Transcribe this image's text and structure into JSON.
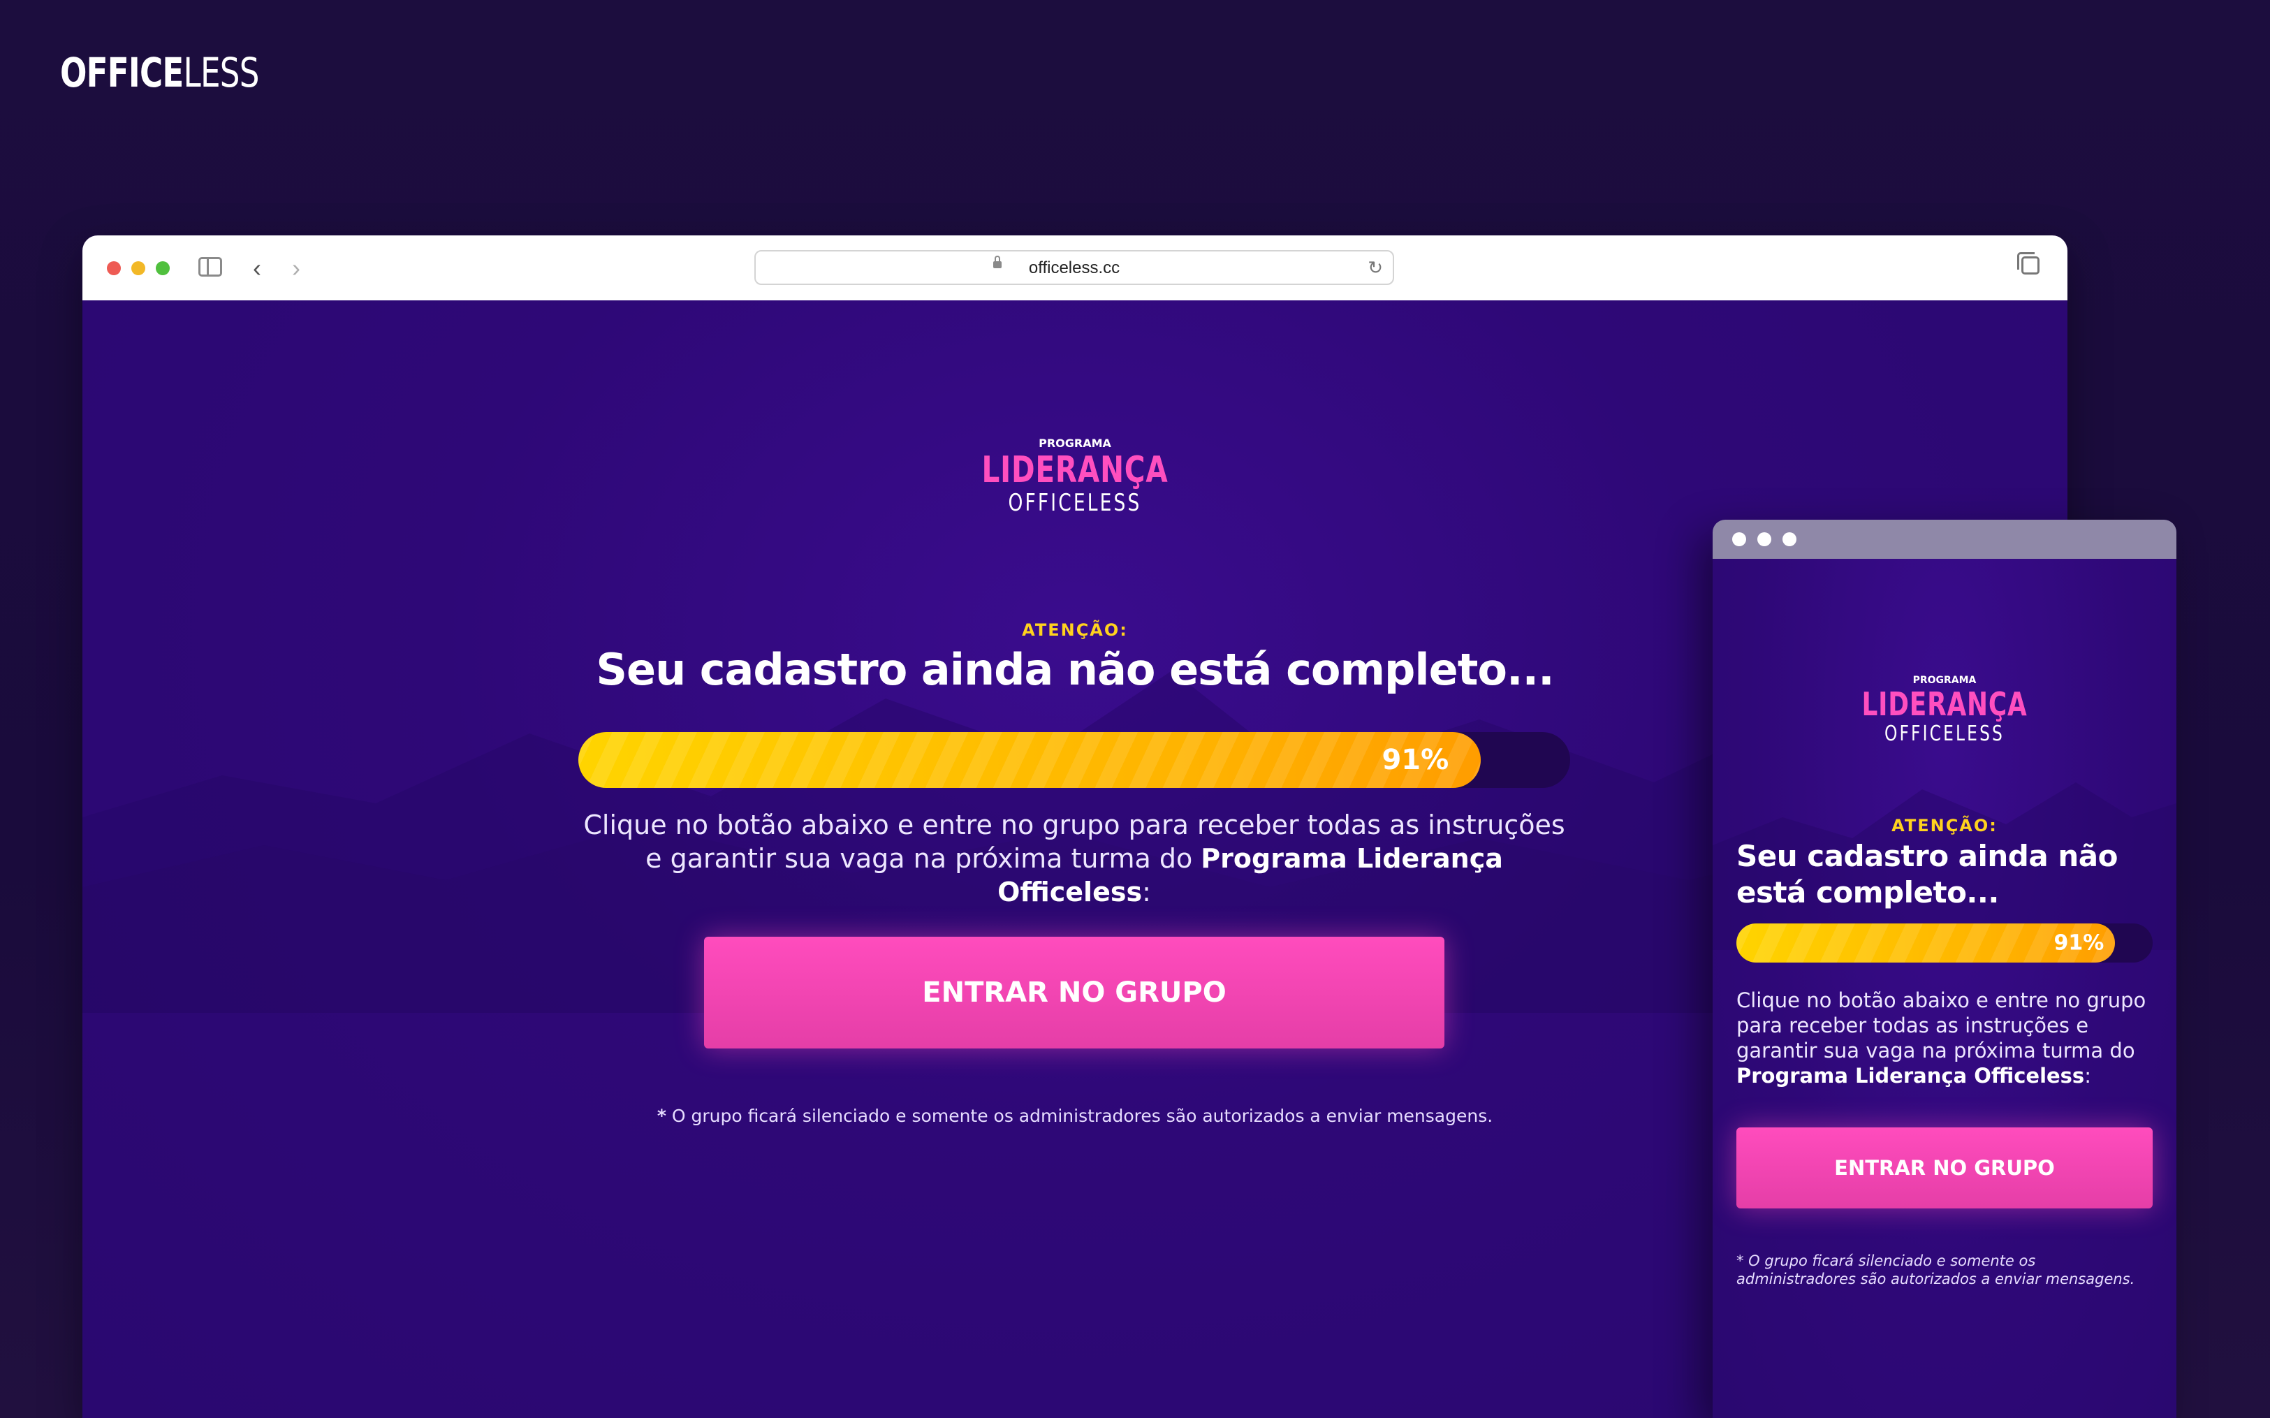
{
  "brand": {
    "bold": "OFFICE",
    "light": "LESS"
  },
  "browser": {
    "url": "officeless.cc",
    "back_icon": "‹",
    "forward_icon": "›",
    "reload_icon": "↻"
  },
  "logo": {
    "pre": "PROGRAMA",
    "main": "LIDERANÇA",
    "sub": "OFFICELESS"
  },
  "attention": "ATENÇÃO:",
  "headline": "Seu cadastro ainda não está completo...",
  "progress": {
    "value": 0.91,
    "label": "91%"
  },
  "description": {
    "text": "Clique no botão abaixo e entre no grupo para receber todas as instruções e garantir sua vaga na próxima turma do ",
    "strong": "Programa Liderança Officeless",
    "end": ":"
  },
  "cta": "ENTRAR NO GRUPO",
  "note": {
    "star": "*",
    "text": " O grupo ficará silenciado e somente os administradores são autorizados a enviar mensagens."
  },
  "colors": {
    "accent": "#ff4fbf",
    "warning": "#ffd21e",
    "bg": "#2e0877",
    "bar": "#ffb200"
  }
}
